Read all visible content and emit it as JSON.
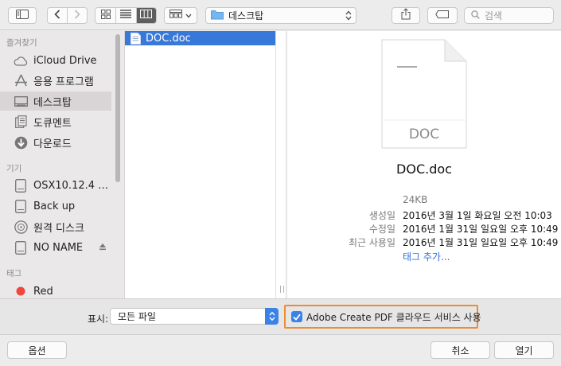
{
  "toolbar": {
    "path_location": "데스크탑",
    "search_placeholder": "검색"
  },
  "sidebar": {
    "favorites_heading": "즐겨찾기",
    "favorites": [
      {
        "label": "iCloud Drive",
        "icon": "cloud-icon"
      },
      {
        "label": "응용 프로그램",
        "icon": "applications-icon"
      },
      {
        "label": "데스크탑",
        "icon": "desktop-icon",
        "selected": true
      },
      {
        "label": "도큐멘트",
        "icon": "documents-icon"
      },
      {
        "label": "다운로드",
        "icon": "downloads-icon"
      }
    ],
    "devices_heading": "기기",
    "devices": [
      {
        "label": "OSX10.12.4 V...",
        "icon": "disk-icon"
      },
      {
        "label": "Back up",
        "icon": "disk-icon"
      },
      {
        "label": "원격 디스크",
        "icon": "remote-disc-icon"
      },
      {
        "label": "NO NAME",
        "icon": "disk-icon",
        "eject": true
      }
    ],
    "tags_heading": "태그",
    "tags": [
      {
        "label": "Red",
        "color": "#f0463c"
      }
    ]
  },
  "files": [
    {
      "name": "DOC.doc",
      "selected": true
    }
  ],
  "preview": {
    "icon_caption": "DOC",
    "filename": "DOC.doc",
    "size": "24KB",
    "created_label": "생성일",
    "created_value": "2016년 3월 1일 화요일 오전 10:03",
    "modified_label": "수정일",
    "modified_value": "2016년 1월 31일 일요일 오후 10:49",
    "last_opened_label": "최근 사용일",
    "last_opened_value": "2016년 1월 31일 일요일 오후 10:49",
    "add_tags": "태그 추가..."
  },
  "options": {
    "show_label": "표시:",
    "show_value": "모든 파일",
    "creative_cloud_label": "Adobe Create PDF 클라우드 서비스 사용",
    "creative_cloud_checked": true
  },
  "footer": {
    "options_button": "옵션",
    "cancel_button": "취소",
    "open_button": "열기"
  },
  "colors": {
    "accent": "#3b82e8",
    "selection": "#3778d9",
    "highlight_box": "#f08a35",
    "tag_red": "#f0463c"
  }
}
